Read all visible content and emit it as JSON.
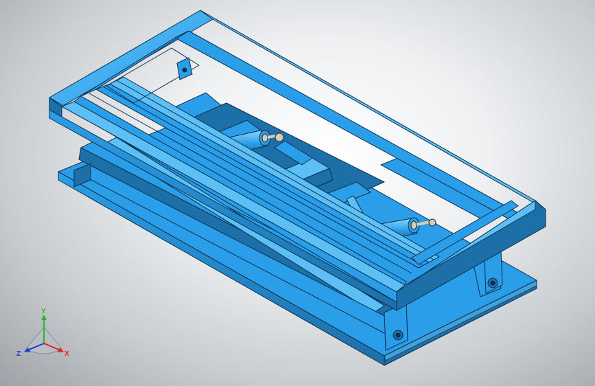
{
  "colors": {
    "part_face": "#2a9ee8",
    "part_light": "#5cc0f7",
    "part_dark": "#1d6fa8",
    "edge": "#0d2f4d",
    "cylinder": "#3aaee8",
    "rod": "#d8cbb0",
    "axis_x": "#e0251b",
    "axis_y": "#2bb52b",
    "axis_z": "#1a3fd6"
  },
  "triad": {
    "x_label": "X",
    "y_label": "Y",
    "z_label": "Z"
  }
}
